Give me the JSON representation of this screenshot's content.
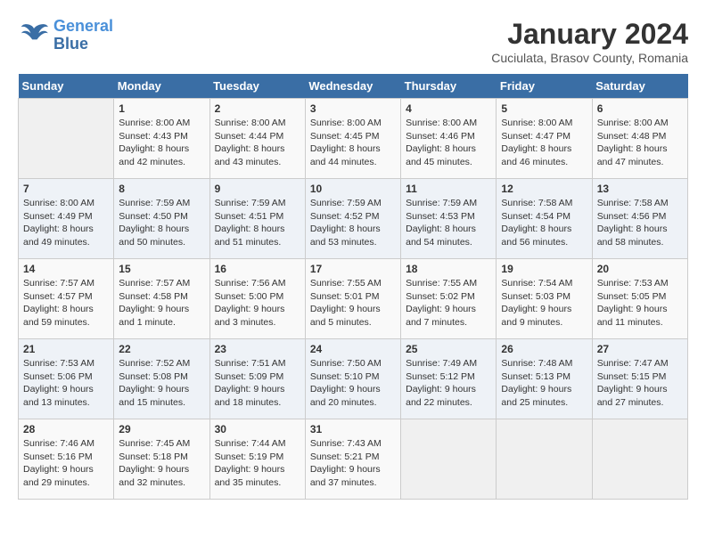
{
  "header": {
    "logo_line1": "General",
    "logo_line2": "Blue",
    "month_title": "January 2024",
    "location": "Cuciulata, Brasov County, Romania"
  },
  "weekdays": [
    "Sunday",
    "Monday",
    "Tuesday",
    "Wednesday",
    "Thursday",
    "Friday",
    "Saturday"
  ],
  "weeks": [
    [
      {
        "day": "",
        "info": ""
      },
      {
        "day": "1",
        "info": "Sunrise: 8:00 AM\nSunset: 4:43 PM\nDaylight: 8 hours\nand 42 minutes."
      },
      {
        "day": "2",
        "info": "Sunrise: 8:00 AM\nSunset: 4:44 PM\nDaylight: 8 hours\nand 43 minutes."
      },
      {
        "day": "3",
        "info": "Sunrise: 8:00 AM\nSunset: 4:45 PM\nDaylight: 8 hours\nand 44 minutes."
      },
      {
        "day": "4",
        "info": "Sunrise: 8:00 AM\nSunset: 4:46 PM\nDaylight: 8 hours\nand 45 minutes."
      },
      {
        "day": "5",
        "info": "Sunrise: 8:00 AM\nSunset: 4:47 PM\nDaylight: 8 hours\nand 46 minutes."
      },
      {
        "day": "6",
        "info": "Sunrise: 8:00 AM\nSunset: 4:48 PM\nDaylight: 8 hours\nand 47 minutes."
      }
    ],
    [
      {
        "day": "7",
        "info": "Sunrise: 8:00 AM\nSunset: 4:49 PM\nDaylight: 8 hours\nand 49 minutes."
      },
      {
        "day": "8",
        "info": "Sunrise: 7:59 AM\nSunset: 4:50 PM\nDaylight: 8 hours\nand 50 minutes."
      },
      {
        "day": "9",
        "info": "Sunrise: 7:59 AM\nSunset: 4:51 PM\nDaylight: 8 hours\nand 51 minutes."
      },
      {
        "day": "10",
        "info": "Sunrise: 7:59 AM\nSunset: 4:52 PM\nDaylight: 8 hours\nand 53 minutes."
      },
      {
        "day": "11",
        "info": "Sunrise: 7:59 AM\nSunset: 4:53 PM\nDaylight: 8 hours\nand 54 minutes."
      },
      {
        "day": "12",
        "info": "Sunrise: 7:58 AM\nSunset: 4:54 PM\nDaylight: 8 hours\nand 56 minutes."
      },
      {
        "day": "13",
        "info": "Sunrise: 7:58 AM\nSunset: 4:56 PM\nDaylight: 8 hours\nand 58 minutes."
      }
    ],
    [
      {
        "day": "14",
        "info": "Sunrise: 7:57 AM\nSunset: 4:57 PM\nDaylight: 8 hours\nand 59 minutes."
      },
      {
        "day": "15",
        "info": "Sunrise: 7:57 AM\nSunset: 4:58 PM\nDaylight: 9 hours\nand 1 minute."
      },
      {
        "day": "16",
        "info": "Sunrise: 7:56 AM\nSunset: 5:00 PM\nDaylight: 9 hours\nand 3 minutes."
      },
      {
        "day": "17",
        "info": "Sunrise: 7:55 AM\nSunset: 5:01 PM\nDaylight: 9 hours\nand 5 minutes."
      },
      {
        "day": "18",
        "info": "Sunrise: 7:55 AM\nSunset: 5:02 PM\nDaylight: 9 hours\nand 7 minutes."
      },
      {
        "day": "19",
        "info": "Sunrise: 7:54 AM\nSunset: 5:03 PM\nDaylight: 9 hours\nand 9 minutes."
      },
      {
        "day": "20",
        "info": "Sunrise: 7:53 AM\nSunset: 5:05 PM\nDaylight: 9 hours\nand 11 minutes."
      }
    ],
    [
      {
        "day": "21",
        "info": "Sunrise: 7:53 AM\nSunset: 5:06 PM\nDaylight: 9 hours\nand 13 minutes."
      },
      {
        "day": "22",
        "info": "Sunrise: 7:52 AM\nSunset: 5:08 PM\nDaylight: 9 hours\nand 15 minutes."
      },
      {
        "day": "23",
        "info": "Sunrise: 7:51 AM\nSunset: 5:09 PM\nDaylight: 9 hours\nand 18 minutes."
      },
      {
        "day": "24",
        "info": "Sunrise: 7:50 AM\nSunset: 5:10 PM\nDaylight: 9 hours\nand 20 minutes."
      },
      {
        "day": "25",
        "info": "Sunrise: 7:49 AM\nSunset: 5:12 PM\nDaylight: 9 hours\nand 22 minutes."
      },
      {
        "day": "26",
        "info": "Sunrise: 7:48 AM\nSunset: 5:13 PM\nDaylight: 9 hours\nand 25 minutes."
      },
      {
        "day": "27",
        "info": "Sunrise: 7:47 AM\nSunset: 5:15 PM\nDaylight: 9 hours\nand 27 minutes."
      }
    ],
    [
      {
        "day": "28",
        "info": "Sunrise: 7:46 AM\nSunset: 5:16 PM\nDaylight: 9 hours\nand 29 minutes."
      },
      {
        "day": "29",
        "info": "Sunrise: 7:45 AM\nSunset: 5:18 PM\nDaylight: 9 hours\nand 32 minutes."
      },
      {
        "day": "30",
        "info": "Sunrise: 7:44 AM\nSunset: 5:19 PM\nDaylight: 9 hours\nand 35 minutes."
      },
      {
        "day": "31",
        "info": "Sunrise: 7:43 AM\nSunset: 5:21 PM\nDaylight: 9 hours\nand 37 minutes."
      },
      {
        "day": "",
        "info": ""
      },
      {
        "day": "",
        "info": ""
      },
      {
        "day": "",
        "info": ""
      }
    ]
  ]
}
